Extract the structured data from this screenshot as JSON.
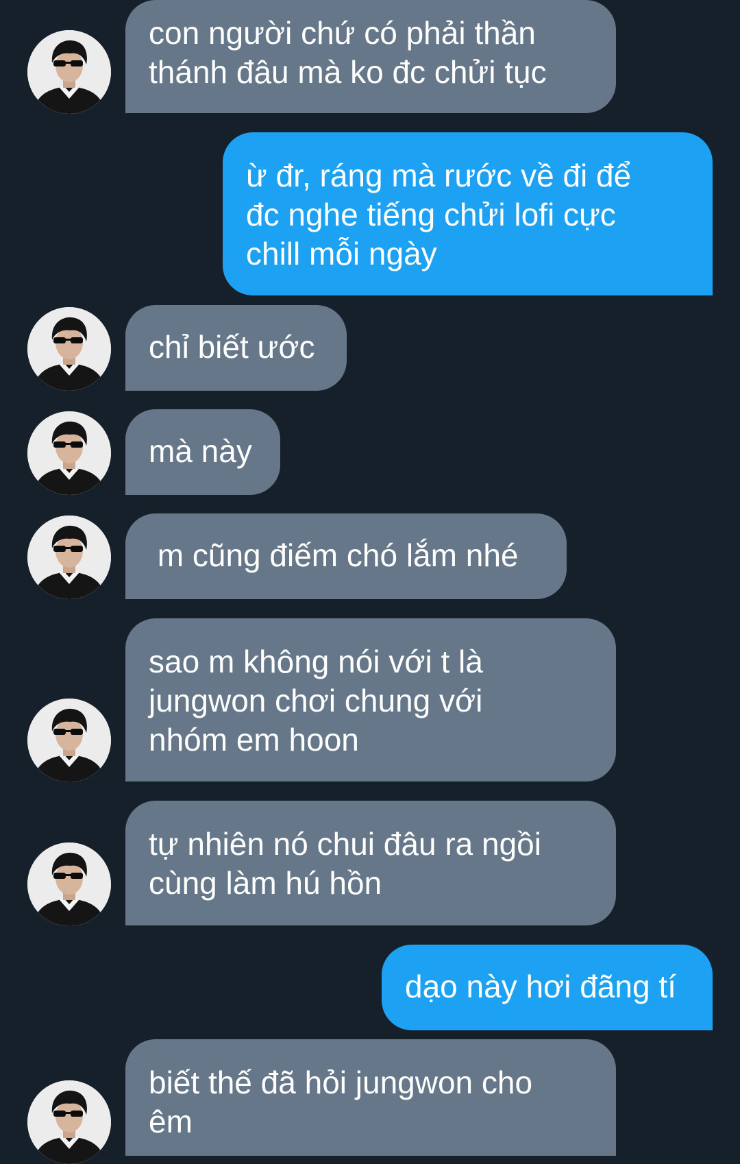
{
  "theme": {
    "background": "#15202b",
    "received_bubble": "#66778a",
    "sent_bubble": "#1da1f2",
    "text": "#ffffff"
  },
  "messages": [
    {
      "sender": "other",
      "text": "con người chứ có phải thần\nthánh đâu mà ko đc chửi tục"
    },
    {
      "sender": "me",
      "text": "ừ đr, ráng mà rước về đi để\nđc nghe tiếng chửi lofi cực\nchill mỗi ngày"
    },
    {
      "sender": "other",
      "text": "chỉ biết ước"
    },
    {
      "sender": "other",
      "text": "mà này"
    },
    {
      "sender": "other",
      "text": " m cũng điếm chó lắm nhé"
    },
    {
      "sender": "other",
      "text": "sao m không nói với t là\njungwon chơi chung với\nnhóm em hoon"
    },
    {
      "sender": "other",
      "text": "tự nhiên nó chui đâu ra ngồi\ncùng làm hú hồn"
    },
    {
      "sender": "me",
      "text": "dạo này hơi đãng tí"
    },
    {
      "sender": "other",
      "text": "biết thế đã hỏi jungwon cho\nêm"
    }
  ]
}
